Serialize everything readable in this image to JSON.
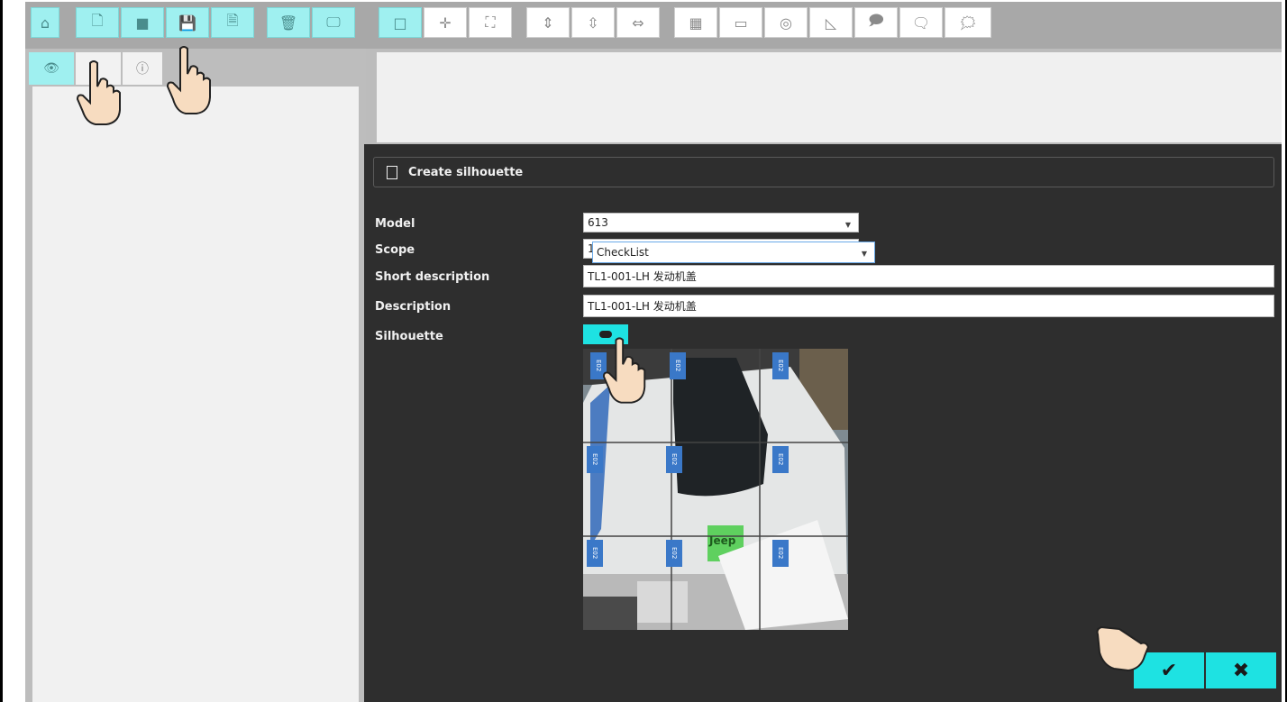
{
  "toolbar": {
    "buttons": [
      {
        "icon": "home-icon",
        "glyph": "⌂"
      },
      {
        "icon": "new-document-icon",
        "glyph": "🗋"
      },
      {
        "icon": "camera-icon",
        "glyph": "■"
      },
      {
        "icon": "save-icon",
        "glyph": "💾"
      },
      {
        "icon": "save-as-icon",
        "glyph": "🗎"
      },
      {
        "icon": "delete-icon",
        "glyph": "🗑"
      },
      {
        "icon": "monitor-icon",
        "glyph": "🖵"
      },
      {
        "icon": "select-rect-icon",
        "glyph": "□"
      },
      {
        "icon": "move-icon",
        "glyph": "✛"
      },
      {
        "icon": "fit-icon",
        "glyph": "⛶"
      },
      {
        "icon": "flip-vertical-icon",
        "glyph": "⇕"
      },
      {
        "icon": "vertical-align-icon",
        "glyph": "⇳"
      },
      {
        "icon": "horizontal-align-icon",
        "glyph": "⇔"
      },
      {
        "icon": "grid-icon",
        "glyph": "▦"
      },
      {
        "icon": "rectangle-icon",
        "glyph": "▭"
      },
      {
        "icon": "circle-icon",
        "glyph": "◎"
      },
      {
        "icon": "polygon-icon",
        "glyph": "◺"
      },
      {
        "icon": "speech-rect-icon",
        "glyph": "🗩"
      },
      {
        "icon": "speech-round-icon",
        "glyph": "🗨"
      },
      {
        "icon": "speech-lasso-icon",
        "glyph": "🗯"
      }
    ]
  },
  "tabs": [
    {
      "icon": "eye-icon",
      "glyph": "👁"
    },
    {
      "icon": "edit-icon",
      "glyph": ""
    },
    {
      "icon": "info-icon",
      "glyph": "ⓘ"
    }
  ],
  "dialog": {
    "title": "Create silhouette",
    "fields": {
      "model_label": "Model",
      "model_value": "613",
      "scope_label": "Scope",
      "scope_value": "CheckList",
      "scope_underlay": "1",
      "short_description_label": "Short description",
      "short_description_value": "TL1-001-LH 发动机盖",
      "description_label": "Description",
      "description_value": "TL1-001-LH 发动机盖",
      "silhouette_label": "Silhouette"
    },
    "photo_tag_text": "E02",
    "photo_logo_text": "Jeep",
    "confirm_glyph": "✔",
    "cancel_glyph": "✖"
  },
  "colors": {
    "accent_cyan": "#1ee2e2",
    "toolbar_cyan": "#9ff0f0",
    "dialog_bg": "#2e2e2e"
  }
}
